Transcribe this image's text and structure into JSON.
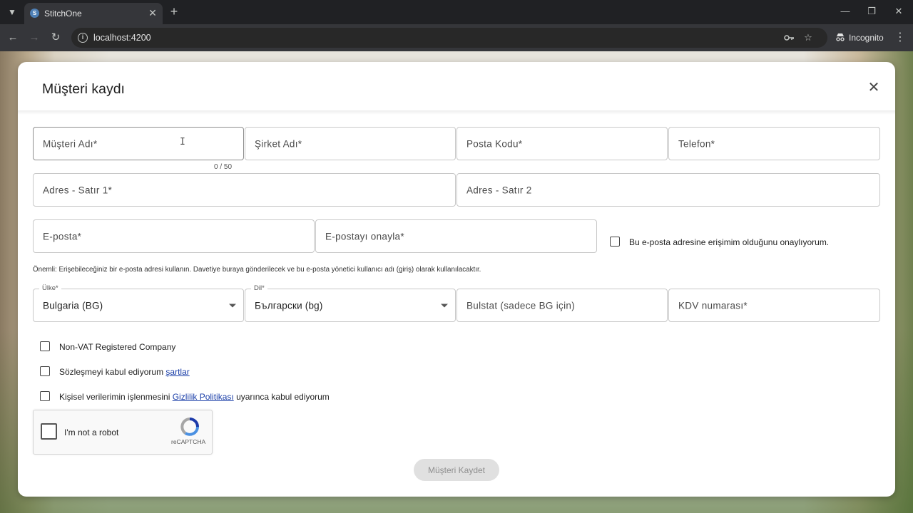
{
  "browser": {
    "tab_title": "StitchOne",
    "tab_favicon": "S",
    "url": "localhost:4200",
    "incognito_label": "Incognito",
    "icons": {
      "tab_menu": "chevron-down-icon",
      "close_tab": "close-icon",
      "new_tab": "plus-icon",
      "back": "arrow-left-icon",
      "forward": "arrow-right-icon",
      "reload": "reload-icon",
      "site_info": "info-icon",
      "passwords": "key-icon",
      "bookmark": "star-icon",
      "incognito": "incognito-icon",
      "menu": "kebab-icon"
    }
  },
  "dialog": {
    "title": "Müşteri kaydı",
    "close_icon": "close-icon",
    "fields": {
      "customer_name": {
        "placeholder": "Müşteri Adı*",
        "counter": "0 / 50"
      },
      "company_name": {
        "placeholder": "Şirket Adı*"
      },
      "postal_code": {
        "placeholder": "Posta Kodu*"
      },
      "phone": {
        "placeholder": "Telefon*"
      },
      "address_line1": {
        "placeholder": "Adres - Satır 1*"
      },
      "address_line2": {
        "placeholder": "Adres - Satır 2"
      },
      "email": {
        "placeholder": "E-posta*"
      },
      "email_confirm": {
        "placeholder": "E-postayı onayla*"
      },
      "country": {
        "label": "Ülke*",
        "value": "Bulgaria (BG)"
      },
      "language": {
        "label": "Dil*",
        "value": "Български (bg)"
      },
      "bulstat": {
        "placeholder": "Bulstat (sadece BG için)"
      },
      "vat": {
        "placeholder": "KDV numarası*"
      }
    },
    "email_access_checkbox": "Bu e-posta adresine erişimim olduğunu onaylıyorum.",
    "note": "Önemli: Erişebileceğiniz bir e-posta adresi kullanın. Davetiye buraya gönderilecek ve bu e-posta yönetici kullanıcı adı (giriş) olarak kullanılacaktır.",
    "checkboxes": {
      "non_vat": "Non-VAT Registered Company",
      "terms_prefix": "Sözleşmeyi kabul ediyorum ",
      "terms_link": "şartlar",
      "privacy_prefix": "Kişisel verilerimin işlenmesini ",
      "privacy_link": "Gizlilik Politikası",
      "privacy_suffix": " uyarınca kabul ediyorum"
    },
    "recaptcha": {
      "label": "I'm not a robot",
      "brand": "reCAPTCHA"
    },
    "submit_label": "Müşteri Kaydet"
  }
}
